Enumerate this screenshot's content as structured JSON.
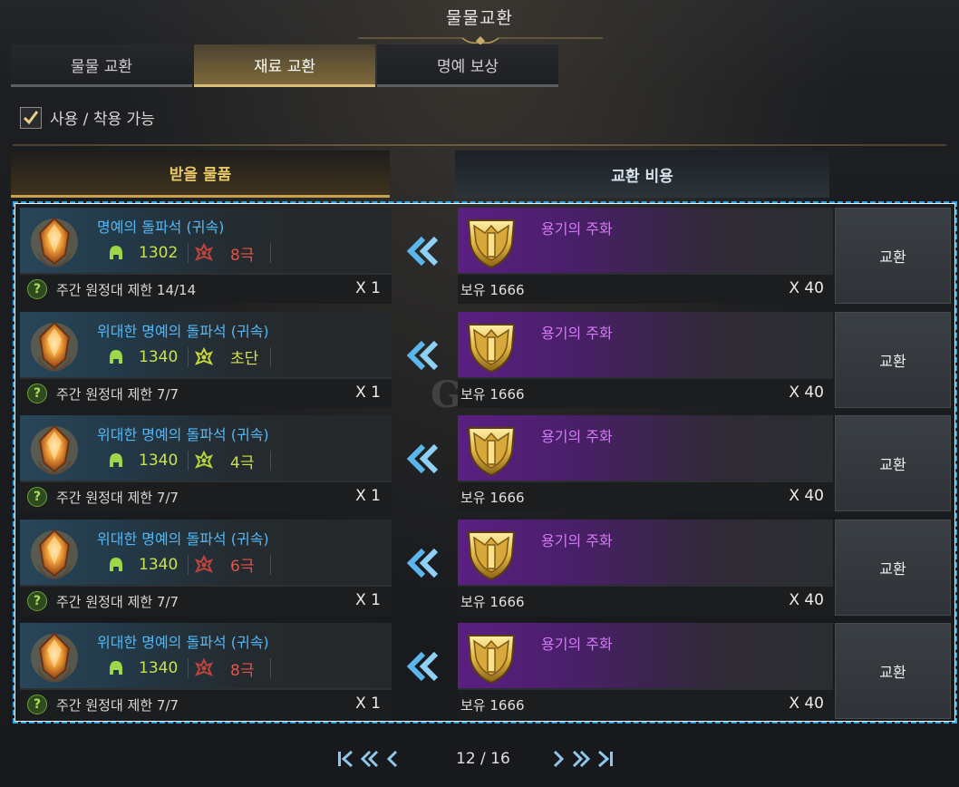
{
  "window": {
    "title": "물물교환"
  },
  "tabs": [
    {
      "label": "물물 교환",
      "active": false
    },
    {
      "label": "재료 교환",
      "active": true
    },
    {
      "label": "명예 보상",
      "active": false
    }
  ],
  "filter": {
    "label": "사용 / 착용 가능",
    "checked": true
  },
  "columns": {
    "receive": "받을 물품",
    "cost": "교환 비용"
  },
  "rows": [
    {
      "item_name": "명예의 돌파석 (귀속)",
      "stat": "1302",
      "grade": "8극",
      "grade_color": "#e0554a",
      "grade_icon_color": "#c0443c",
      "limit": "주간 원정대 제한 14/14",
      "recv_qty": "X 1",
      "cost_name": "용기의 주화",
      "owned": "보유 1666",
      "cost_qty": "X 40",
      "button": "교환"
    },
    {
      "item_name": "위대한 명예의 돌파석 (귀속)",
      "stat": "1340",
      "grade": "초단",
      "grade_color": "#d8e04a",
      "grade_icon_color": "#c7d43a",
      "limit": "주간 원정대 제한 7/7",
      "recv_qty": "X 1",
      "cost_name": "용기의 주화",
      "owned": "보유 1666",
      "cost_qty": "X 40",
      "button": "교환"
    },
    {
      "item_name": "위대한 명예의 돌파석 (귀속)",
      "stat": "1340",
      "grade": "4극",
      "grade_color": "#c9e34a",
      "grade_icon_color": "#b7d43a",
      "limit": "주간 원정대 제한 7/7",
      "recv_qty": "X 1",
      "cost_name": "용기의 주화",
      "owned": "보유 1666",
      "cost_qty": "X 40",
      "button": "교환"
    },
    {
      "item_name": "위대한 명예의 돌파석 (귀속)",
      "stat": "1340",
      "grade": "6극",
      "grade_color": "#e0554a",
      "grade_icon_color": "#c0443c",
      "limit": "주간 원정대 제한 7/7",
      "recv_qty": "X 1",
      "cost_name": "용기의 주화",
      "owned": "보유 1666",
      "cost_qty": "X 40",
      "button": "교환"
    },
    {
      "item_name": "위대한 명예의 돌파석 (귀속)",
      "stat": "1340",
      "grade": "8극",
      "grade_color": "#e0554a",
      "grade_icon_color": "#c0443c",
      "limit": "주간 원정대 제한 7/7",
      "recv_qty": "X 1",
      "cost_name": "용기의 주화",
      "owned": "보유 1666",
      "cost_qty": "X 40",
      "button": "교환"
    }
  ],
  "pagination": {
    "text": "12 / 16"
  },
  "colors": {
    "accent_gold": "#d8c07a",
    "item_blue": "#53b7f5",
    "coin_purple": "#d27cf3",
    "list_border": "#32a8e6"
  }
}
